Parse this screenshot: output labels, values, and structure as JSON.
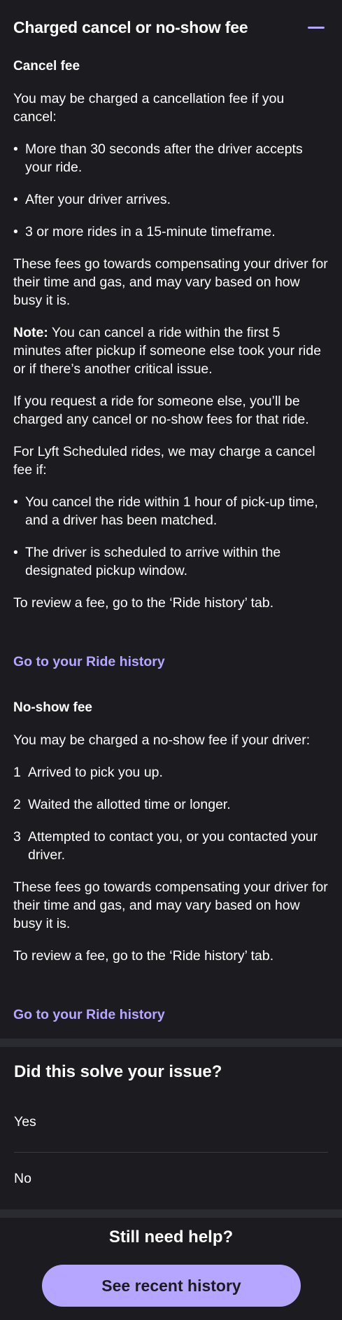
{
  "header": {
    "title": "Charged cancel or no-show fee",
    "collapse_icon": "minus-icon"
  },
  "cancel": {
    "heading": "Cancel fee",
    "intro": "You may be charged a cancellation fee if you cancel:",
    "bullets": [
      "More than 30 seconds after the driver accepts your ride.",
      "After your driver arrives.",
      "3 or more rides in a 15-minute timeframe."
    ],
    "fees_text": "These fees go towards compensating your driver for their time and gas, and may vary based on how busy it is.",
    "note_label": "Note:",
    "note_text": " You can cancel a ride within the first 5 minutes after pickup if someone else took your ride or if there’s another critical issue.",
    "someone_else": "If you request a ride for someone else, you’ll be charged any cancel or no-show fees for that ride.",
    "scheduled_intro": "For Lyft Scheduled rides, we may charge a cancel fee if:",
    "scheduled_bullets": [
      "You cancel the ride within 1 hour of pick-up time, and a driver has been matched.",
      "The driver is scheduled to arrive within the designated pickup window."
    ],
    "review": "To review a fee, go to the ‘Ride history’ tab.",
    "link": "Go to your Ride history"
  },
  "noshow": {
    "heading": "No-show fee",
    "intro": "You may be charged a no-show fee if your driver:",
    "items": [
      {
        "num": "1",
        "text": "Arrived to pick you up."
      },
      {
        "num": "2",
        "text": "Waited the allotted time or longer."
      },
      {
        "num": "3",
        "text": "Attempted to contact you, or you contacted your driver."
      }
    ],
    "fees_text": "These fees go towards compensating your driver for their time and gas, and may vary based on how busy it is.",
    "review": "To review a fee, go to the ‘Ride history’ tab.",
    "link": "Go to your Ride history"
  },
  "feedback": {
    "title": "Did this solve your issue?",
    "yes": "Yes",
    "no": "No"
  },
  "help": {
    "title": "Still need help?",
    "button": "See recent history"
  },
  "colors": {
    "accent": "#b7a6ff",
    "background": "#1b1b20",
    "band": "#2a2a31"
  }
}
